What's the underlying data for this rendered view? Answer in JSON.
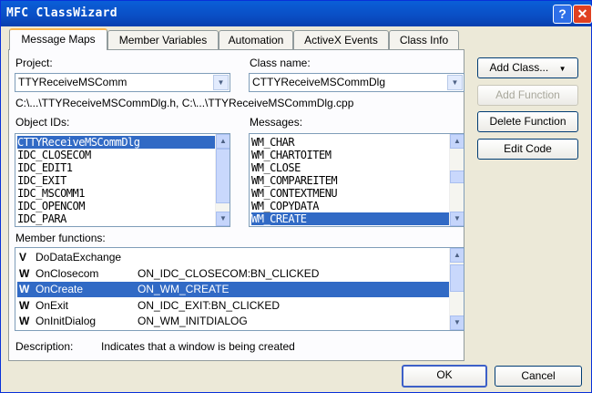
{
  "window": {
    "title": "MFC ClassWizard",
    "help_glyph": "?",
    "close_glyph": "✕"
  },
  "tabs": [
    "Message Maps",
    "Member Variables",
    "Automation",
    "ActiveX Events",
    "Class Info"
  ],
  "project": {
    "label": "Project:",
    "value": "TTYReceiveMSComm"
  },
  "class_name": {
    "label": "Class name:",
    "value": "CTTYReceiveMSCommDlg"
  },
  "files_path": "C:\\...\\TTYReceiveMSCommDlg.h, C:\\...\\TTYReceiveMSCommDlg.cpp",
  "object_ids": {
    "label": "Object IDs:",
    "items": [
      "CTTYReceiveMSCommDlg",
      "IDC_CLOSECOM",
      "IDC_EDIT1",
      "IDC_EXIT",
      "IDC_MSCOMM1",
      "IDC_OPENCOM",
      "IDC_PARA"
    ],
    "selected_index": 0
  },
  "messages": {
    "label": "Messages:",
    "items": [
      "WM_CHAR",
      "WM_CHARTOITEM",
      "WM_CLOSE",
      "WM_COMPAREITEM",
      "WM_CONTEXTMENU",
      "WM_COPYDATA",
      "WM_CREATE"
    ],
    "selected_index": 6
  },
  "member_functions": {
    "label": "Member functions:",
    "rows": [
      {
        "type": "V",
        "name": "DoDataExchange",
        "handler": ""
      },
      {
        "type": "W",
        "name": "OnClosecom",
        "handler": "ON_IDC_CLOSECOM:BN_CLICKED"
      },
      {
        "type": "W",
        "name": "OnCreate",
        "handler": "ON_WM_CREATE"
      },
      {
        "type": "W",
        "name": "OnExit",
        "handler": "ON_IDC_EXIT:BN_CLICKED"
      },
      {
        "type": "W",
        "name": "OnInitDialog",
        "handler": "ON_WM_INITDIALOG"
      }
    ],
    "selected_index": 2
  },
  "description": {
    "label": "Description:",
    "text": "Indicates that a window is being created"
  },
  "buttons": {
    "add_class": "Add Class...",
    "add_function": "Add Function",
    "delete_function": "Delete Function",
    "edit_code": "Edit Code",
    "ok": "OK",
    "cancel": "Cancel"
  },
  "glyphs": {
    "drop": "▼",
    "up": "▲",
    "down": "▼",
    "menu": "▼"
  },
  "colors": {
    "title_bar": "#0a4ec4",
    "selection": "#316ac5",
    "dialog_bg": "#ece9d8"
  }
}
